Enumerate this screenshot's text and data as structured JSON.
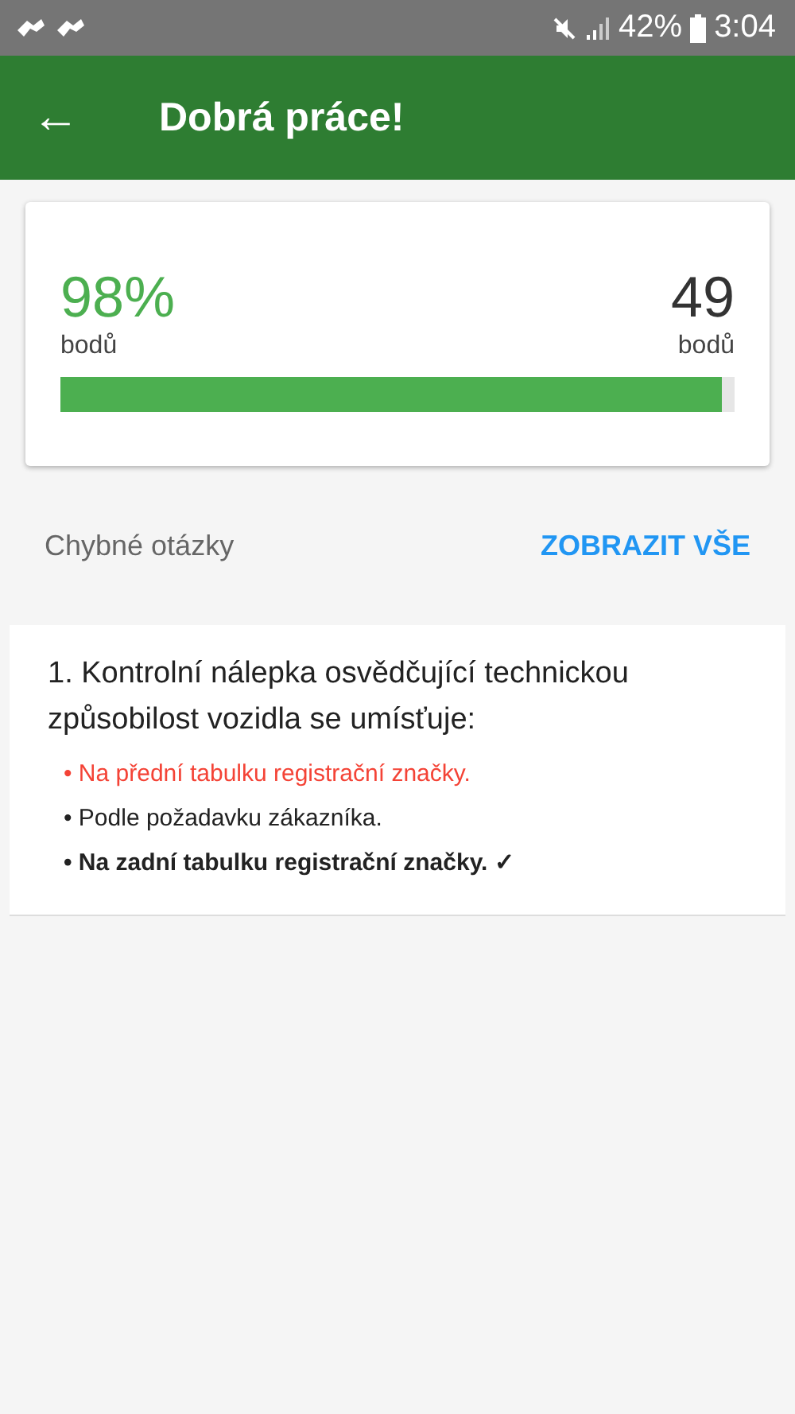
{
  "status_bar": {
    "battery": "42%",
    "time": "3:04"
  },
  "toolbar": {
    "back": "←",
    "title": "Dobrá práce!"
  },
  "score": {
    "percent": "98%",
    "percent_unit": "bodů",
    "points": "49",
    "points_unit": "bodů",
    "level": 0.98
  },
  "section": {
    "title": "Chybné otázky",
    "action": "ZOBRAZIT VŠE"
  },
  "questions": [
    {
      "text": "1. Kontrolní nálepka osvědčující technickou způsobilost vozidla se umísťuje:",
      "answers": [
        {
          "kind": "wrong",
          "text": "• Na přední tabulku registrační značky."
        },
        {
          "kind": "neutral",
          "text": "• Podle požadavku zákazníka."
        },
        {
          "kind": "correct",
          "text": "• Na zadní tabulku registrační značky. ✓"
        }
      ]
    }
  ]
}
